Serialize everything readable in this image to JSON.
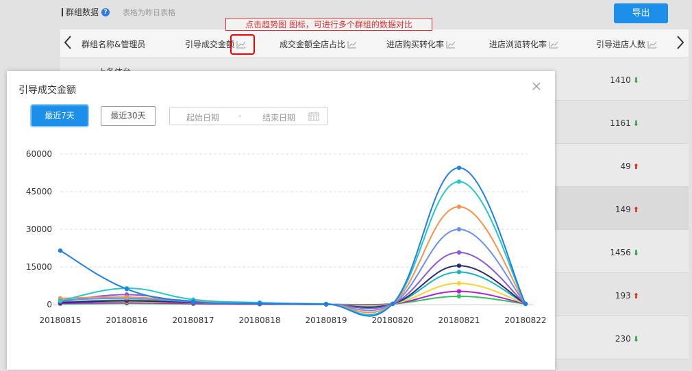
{
  "page": {
    "section_title": "群组数据",
    "help_glyph": "?",
    "section_subtitle": "表格为昨日表格",
    "export_label": "导出",
    "annotation": "点击趋势图 图标，可进行多个群组的数据对比"
  },
  "table": {
    "columns": [
      "群组名称&管理员",
      "引导成交金额",
      "成交金额全店占比",
      "进店购买转化率",
      "进店浏览转化率",
      "引导进店人数"
    ],
    "partial_row_text": "上各体台",
    "rows": [
      {
        "value": "1410",
        "trend": "down"
      },
      {
        "value": "1161",
        "trend": "down"
      },
      {
        "value": "49",
        "trend": "up"
      },
      {
        "value": "149",
        "trend": "up"
      },
      {
        "value": "1456",
        "trend": "down"
      },
      {
        "value": "193",
        "trend": "up"
      },
      {
        "value": "230",
        "trend": "down"
      }
    ]
  },
  "modal": {
    "title": "引导成交金额",
    "btn_7days": "最近7天",
    "btn_30days": "最近30天",
    "date_start_placeholder": "起始日期",
    "date_separator": "-",
    "date_end_placeholder": "结束日期"
  },
  "colors": {
    "accent": "#1c8fea",
    "up": "#d9261c",
    "down": "#25a244",
    "annotation": "#e23030"
  },
  "chart_data": {
    "type": "line",
    "smooth": true,
    "categories": [
      "20180815",
      "20180816",
      "20180817",
      "20180818",
      "20180819",
      "20180820",
      "20180821",
      "20180822"
    ],
    "ylim": [
      0,
      60000
    ],
    "yticks": [
      0,
      15000,
      30000,
      45000,
      60000
    ],
    "grid": "horizontal-dashed",
    "series": [
      {
        "color": "#1f7fe6",
        "values": [
          21500,
          6200,
          1200,
          500,
          200,
          300,
          54500,
          300
        ]
      },
      {
        "color": "#22c7c7",
        "values": [
          1500,
          6500,
          2000,
          800,
          300,
          300,
          49000,
          300
        ]
      },
      {
        "color": "#f5924b",
        "values": [
          2500,
          3000,
          1500,
          600,
          200,
          300,
          39000,
          300
        ]
      },
      {
        "color": "#6b8ff0",
        "values": [
          1800,
          2500,
          1200,
          500,
          200,
          300,
          30000,
          300
        ]
      },
      {
        "color": "#8a5ad6",
        "values": [
          1200,
          4000,
          1000,
          400,
          200,
          300,
          20800,
          300
        ]
      },
      {
        "color": "#2b2e6b",
        "values": [
          800,
          1500,
          800,
          300,
          100,
          300,
          15500,
          300
        ]
      },
      {
        "color": "#17b3c0",
        "values": [
          1000,
          1800,
          900,
          300,
          100,
          300,
          13000,
          300
        ]
      },
      {
        "color": "#f6d32d",
        "values": [
          1300,
          1200,
          700,
          300,
          100,
          300,
          8500,
          300
        ]
      },
      {
        "color": "#b21dd6",
        "values": [
          500,
          800,
          400,
          200,
          100,
          300,
          5300,
          300
        ]
      },
      {
        "color": "#2ec45a",
        "values": [
          300,
          500,
          300,
          200,
          100,
          300,
          3300,
          300
        ]
      }
    ]
  }
}
